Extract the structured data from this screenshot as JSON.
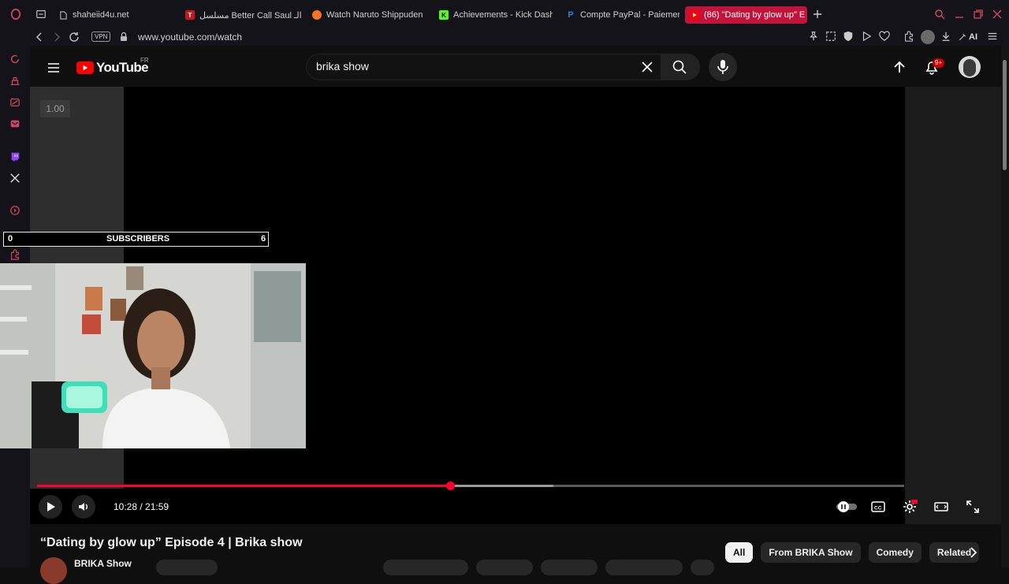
{
  "colors": {
    "accent": "#c2133a",
    "youtube_red": "#ff0033",
    "background": "#0f0f0f"
  },
  "browser": {
    "tabs": [
      {
        "label": "shaheiid4u.net",
        "icon": "page-icon"
      },
      {
        "label": "مسلسل Better Call Saul الـ",
        "icon": "top-site-icon"
      },
      {
        "label": "Watch Naruto Shippuden -",
        "icon": "crunchyroll-icon"
      },
      {
        "label": "Achievements - Kick Dash",
        "icon": "kick-icon"
      },
      {
        "label": "Compte PayPal - Paiemen",
        "icon": "paypal-icon"
      },
      {
        "label": "(86) \"Dating by glow up\" E",
        "icon": "youtube-icon",
        "active": true
      }
    ],
    "vpn_label": "VPN",
    "url": "www.youtube.com/watch",
    "ai_label": "AI"
  },
  "youtube": {
    "logo_text": "YouTube",
    "region": "FR",
    "search_value": "brika show",
    "notification_count": "9+"
  },
  "player": {
    "speed_label": "1.00",
    "subscriber_bar": {
      "label": "SUBSCRIBERS",
      "left_value": "0",
      "right_value": "6"
    },
    "current_time": "10:28",
    "duration": "21:59",
    "time_display": "10:28 / 21:59",
    "progress_fraction": 0.476,
    "buffer_fraction": 0.595
  },
  "video": {
    "title": "“Dating by glow up” Episode 4 | Brika show",
    "channel_name": "BRIKA Show"
  },
  "chips": [
    "All",
    "From BRIKA Show",
    "Comedy",
    "Related"
  ]
}
